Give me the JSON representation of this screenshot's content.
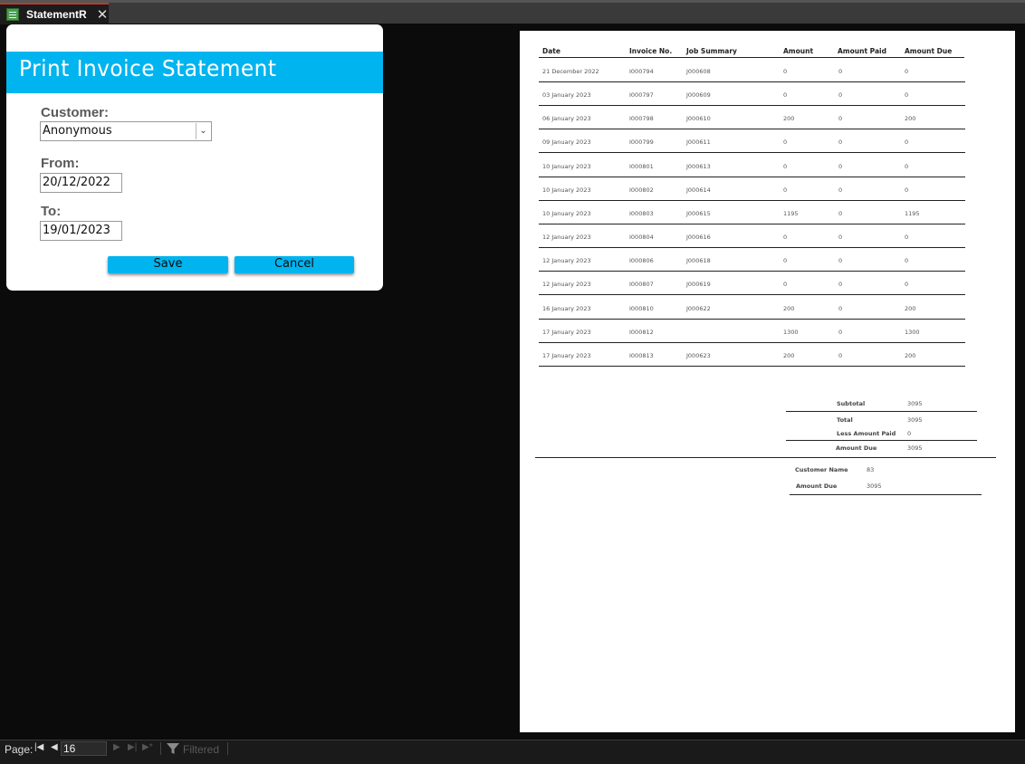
{
  "tab": {
    "label": "StatementR",
    "icon": "report-icon",
    "close_icon": "close-icon"
  },
  "dialog": {
    "title": "Print Invoice Statement",
    "customer_label": "Customer:",
    "customer_value": "Anonymous",
    "from_label": "From:",
    "from_value": "20/12/2022",
    "to_label": "To:",
    "to_value": "19/01/2023",
    "save_label": "Save",
    "cancel_label": "Cancel",
    "accent_color": "#00b4ef"
  },
  "report": {
    "headers": {
      "date": "Date",
      "invoice": "Invoice No.",
      "job": "Job Summary",
      "amount": "Amount",
      "paid": "Amount Paid",
      "due": "Amount Due"
    },
    "rows": [
      {
        "date": "21 December 2022",
        "invoice": "I000794",
        "job": "J000608",
        "amount": "0",
        "paid": "0",
        "due": "0"
      },
      {
        "date": "03 January 2023",
        "invoice": "I000797",
        "job": "J000609",
        "amount": "0",
        "paid": "0",
        "due": "0"
      },
      {
        "date": "06 January 2023",
        "invoice": "I000798",
        "job": "J000610",
        "amount": "200",
        "paid": "0",
        "due": "200"
      },
      {
        "date": "09 January 2023",
        "invoice": "I000799",
        "job": "J000611",
        "amount": "0",
        "paid": "0",
        "due": "0"
      },
      {
        "date": "10 January 2023",
        "invoice": "I000801",
        "job": "J000613",
        "amount": "0",
        "paid": "0",
        "due": "0"
      },
      {
        "date": "10 January 2023",
        "invoice": "I000802",
        "job": "J000614",
        "amount": "0",
        "paid": "0",
        "due": "0"
      },
      {
        "date": "10 January 2023",
        "invoice": "I000803",
        "job": "J000615",
        "amount": "1195",
        "paid": "0",
        "due": "1195"
      },
      {
        "date": "12 January 2023",
        "invoice": "I000804",
        "job": "J000616",
        "amount": "0",
        "paid": "0",
        "due": "0"
      },
      {
        "date": "12 January 2023",
        "invoice": "I000806",
        "job": "J000618",
        "amount": "0",
        "paid": "0",
        "due": "0"
      },
      {
        "date": "12 January 2023",
        "invoice": "I000807",
        "job": "J000619",
        "amount": "0",
        "paid": "0",
        "due": "0"
      },
      {
        "date": "16 January 2023",
        "invoice": "I000810",
        "job": "J000622",
        "amount": "200",
        "paid": "0",
        "due": "200"
      },
      {
        "date": "17 January 2023",
        "invoice": "I000812",
        "job": "",
        "amount": "1300",
        "paid": "0",
        "due": "1300"
      },
      {
        "date": "17 January 2023",
        "invoice": "I000813",
        "job": "J000623",
        "amount": "200",
        "paid": "0",
        "due": "200"
      }
    ],
    "summary": {
      "subtotal_label": "Subtotal",
      "subtotal": "3095",
      "total_label": "Total",
      "total": "3095",
      "less_paid_label": "Less Amount Paid",
      "less_paid": "0",
      "amount_due_label": "Amount Due",
      "amount_due": "3095"
    },
    "footer": {
      "customer_name_label": "Customer Name",
      "customer_name": "83",
      "amount_due_label": "Amount Due",
      "amount_due": "3095"
    }
  },
  "statusbar": {
    "page_label": "Page:",
    "page_value": "16",
    "filter_label": "Filtered",
    "first_icon": "first-page-icon",
    "prev_icon": "prev-page-icon",
    "next_icon": "next-page-icon",
    "last_icon": "last-page-icon",
    "new_icon": "new-record-icon",
    "filter_icon": "filter-icon"
  }
}
